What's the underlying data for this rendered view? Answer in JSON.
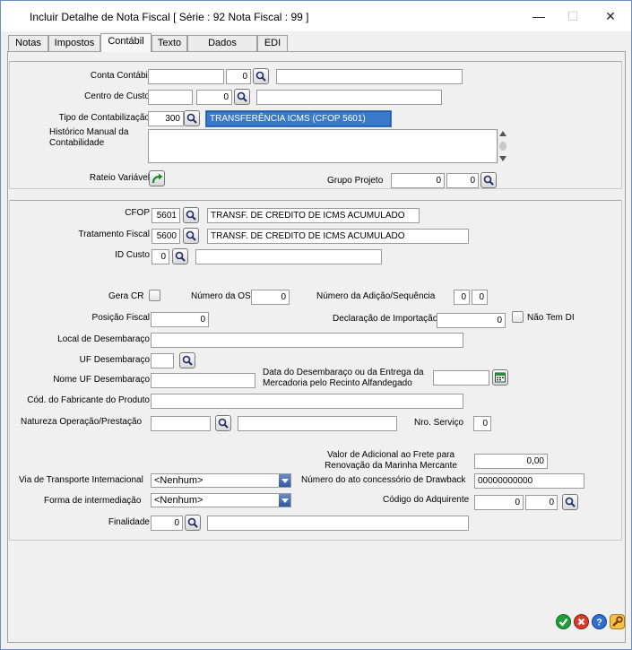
{
  "window": {
    "title": "Incluir Detalhe de Nota Fiscal [ Série : 92 Nota Fiscal : 99 ]",
    "minimize": "—",
    "maximize": "☐",
    "close": "✕"
  },
  "tabs": [
    {
      "label": "Notas"
    },
    {
      "label": "Impostos"
    },
    {
      "label": "Contábil"
    },
    {
      "label": "Texto"
    },
    {
      "label": "Dados Seguro"
    },
    {
      "label": "EDI"
    }
  ],
  "contabil": {
    "conta_contabil_label": "Conta Contábil",
    "conta_contabil_code": "",
    "conta_contabil_digit": "0",
    "conta_contabil_desc": "",
    "centro_custo_label": "Centro de Custo",
    "centro_custo_code": "",
    "centro_custo_digit": "0",
    "centro_custo_desc": "",
    "tipo_contab_label": "Tipo de Contabilização",
    "tipo_contab_code": "300",
    "tipo_contab_desc": "TRANSFERÊNCIA ICMS (CFOP 5601)",
    "historico_label": "Histórico Manual da Contabilidade",
    "historico_value": "",
    "rateio_label": "Rateio Variável",
    "grupo_projeto_label": "Grupo Projeto",
    "grupo_projeto_a": "0",
    "grupo_projeto_b": "0"
  },
  "fiscal": {
    "cfop_label": "CFOP",
    "cfop_code": "5601",
    "cfop_desc": "TRANSF. DE CREDITO DE ICMS ACUMULADO",
    "trat_label": "Tratamento Fiscal",
    "trat_code": "5600",
    "trat_desc": "TRANSF. DE CREDITO DE ICMS ACUMULADO",
    "id_custo_label": "ID Custo",
    "id_custo_code": "0",
    "id_custo_desc": "",
    "gera_cr_label": "Gera CR",
    "numero_os_label": "Número da OS",
    "numero_os_value": "0",
    "adicao_label": "Número da Adição/Sequência",
    "adicao_a": "0",
    "adicao_b": "0",
    "posicao_fiscal_label": "Posição Fiscal",
    "posicao_fiscal_value": "0",
    "decl_import_label": "Declaração de Importação",
    "decl_import_value": "0",
    "nao_tem_di_label": "Não Tem  DI",
    "local_desemb_label": "Local de Desembaraço",
    "local_desemb_value": "",
    "uf_desemb_label": "UF Desembaraço",
    "uf_desemb_value": "",
    "nome_uf_label": "Nome UF Desembaraço",
    "nome_uf_value": "",
    "data_desemb_label": "Data do Desembaraço ou da Entrega da Mercadoria pelo Recinto Alfandegado",
    "data_desemb_value": "",
    "cod_fabricante_label": "Cód. do Fabricante do Produto",
    "cod_fabricante_value": "",
    "natureza_label": "Natureza Operação/Prestação",
    "natureza_code": "",
    "natureza_desc": "",
    "nro_servico_label": "Nro. Serviço",
    "nro_servico_value": "0",
    "valor_adicional_label": "Valor de Adicional ao Frete para Renovação da Marinha Mercante",
    "valor_adicional_value": "0,00",
    "via_transporte_label": "Via de Transporte Internacional",
    "via_transporte_value": "<Nenhum>",
    "num_drawback_label": "Número do ato concessório de Drawback",
    "num_drawback_value": "00000000000",
    "forma_intermed_label": "Forma de intermediação",
    "forma_intermed_value": "<Nenhum>",
    "cod_adquirente_label": "Código do Adquirente",
    "cod_adquirente_a": "0",
    "cod_adquirente_b": "0",
    "finalidade_label": "Finalidade",
    "finalidade_code": "0",
    "finalidade_desc": ""
  },
  "colors": {
    "ok": "#1f9e3a",
    "cancel": "#d93a2b",
    "help": "#2f6fd0",
    "tools": "#e2a21a"
  }
}
